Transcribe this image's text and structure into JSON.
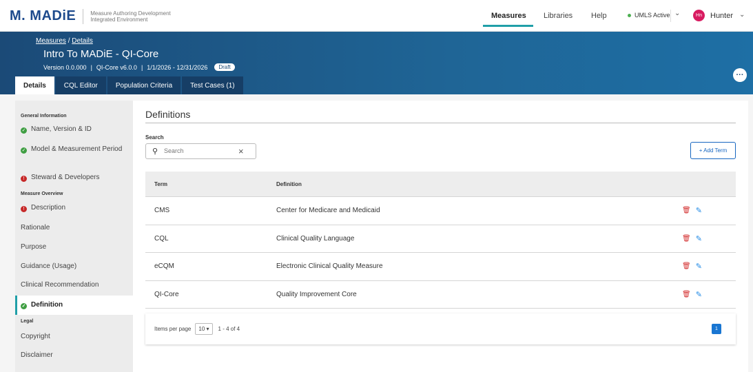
{
  "app": {
    "logo": "MADiE",
    "subtitle_line1": "Measure Authoring Development",
    "subtitle_line2": "Integrated Environment"
  },
  "topnav": {
    "links": [
      "Measures",
      "Libraries",
      "Help"
    ],
    "active": "Measures",
    "umls": "UMLS Active",
    "avatar": "Hn",
    "user": "Hunter"
  },
  "header": {
    "breadcrumb_measures": "Measures",
    "breadcrumb_sep": "/",
    "breadcrumb_details": "Details",
    "title": "Intro To MADiE - QI-Core",
    "version": "Version 0.0.000",
    "model": "QI-Core v6.0.0",
    "period": "1/1/2026 - 12/31/2026",
    "status": "Draft",
    "more": "···"
  },
  "tabs": [
    "Details",
    "CQL Editor",
    "Population Criteria",
    "Test Cases (1)"
  ],
  "sidebar": {
    "sections": [
      "General Information",
      "Measure Overview",
      "Legal"
    ],
    "items": [
      {
        "label": "Name, Version & ID",
        "status": "ok"
      },
      {
        "label": "Model & Measurement Period",
        "status": "ok"
      },
      {
        "label": "Steward & Developers",
        "status": "error"
      },
      {
        "label": "Description",
        "status": "error"
      },
      {
        "label": "Rationale",
        "status": ""
      },
      {
        "label": "Purpose",
        "status": ""
      },
      {
        "label": "Guidance (Usage)",
        "status": ""
      },
      {
        "label": "Clinical Recommendation",
        "status": ""
      },
      {
        "label": "Definition",
        "status": "ok"
      },
      {
        "label": "Copyright",
        "status": ""
      },
      {
        "label": "Disclaimer",
        "status": ""
      }
    ],
    "active": "Definition"
  },
  "main": {
    "title": "Definitions",
    "search_label": "Search",
    "search_placeholder": "Search",
    "search_value": "",
    "add_button": "+ Add Term",
    "columns": [
      "Term",
      "Definition"
    ],
    "rows": [
      {
        "term": "CMS",
        "definition": "Center for Medicare and Medicaid"
      },
      {
        "term": "CQL",
        "definition": "Clinical Quality Language"
      },
      {
        "term": "eCQM",
        "definition": "Electronic Clinical Quality Measure"
      },
      {
        "term": "QI-Core",
        "definition": "Quality Improvement Core"
      }
    ],
    "items_per_page_label": "Items per page",
    "items_per_page": "10",
    "range": "1 - 4 of 4",
    "current_page": "1"
  },
  "colors": {
    "accent": "#209fa8",
    "band": "#1b4a77",
    "primary": "#1565c0",
    "ok": "#3f9e42",
    "error": "#c62828",
    "delete": "#d32f2f"
  }
}
